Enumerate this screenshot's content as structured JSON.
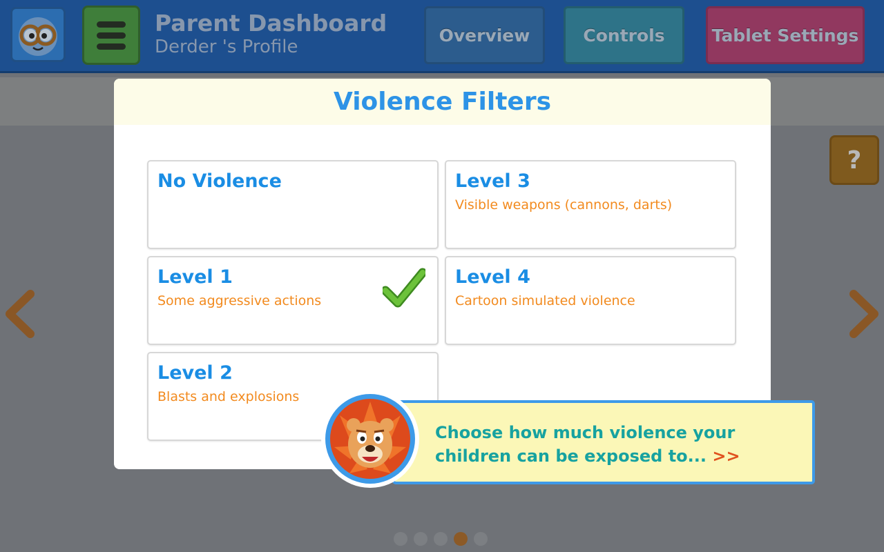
{
  "header": {
    "title": "Parent Dashboard",
    "subtitle": "Derder 's Profile",
    "tabs": [
      "Overview",
      "Controls",
      "Tablet Settings"
    ]
  },
  "help_label": "?",
  "modal": {
    "title": "Violence Filters",
    "options": [
      {
        "label": "No Violence",
        "description": "",
        "selected": false
      },
      {
        "label": "Level 3",
        "description": "Visible weapons (cannons, darts)",
        "selected": false
      },
      {
        "label": "Level 1",
        "description": "Some aggressive actions",
        "selected": true
      },
      {
        "label": "Level 4",
        "description": "Cartoon simulated violence",
        "selected": false
      },
      {
        "label": "Level 2",
        "description": "Blasts and explosions",
        "selected": false
      }
    ]
  },
  "tooltip": {
    "text": "Choose how much violence your children can be exposed to...",
    "more": ">>"
  },
  "pagination": {
    "total": 5,
    "current": 4
  },
  "icons": {
    "logo": "owl-face-icon",
    "menu": "hamburger-menu-icon",
    "help": "question-mark-icon",
    "prev": "chevron-left-icon",
    "next": "chevron-right-icon",
    "check": "checkmark-icon",
    "mascot": "lion-mascot-icon"
  },
  "colors": {
    "title_blue": "#2d93e6",
    "desc_orange": "#f28a1e",
    "tooltip_teal": "#17a2a0",
    "check_green": "#6cc23a"
  }
}
